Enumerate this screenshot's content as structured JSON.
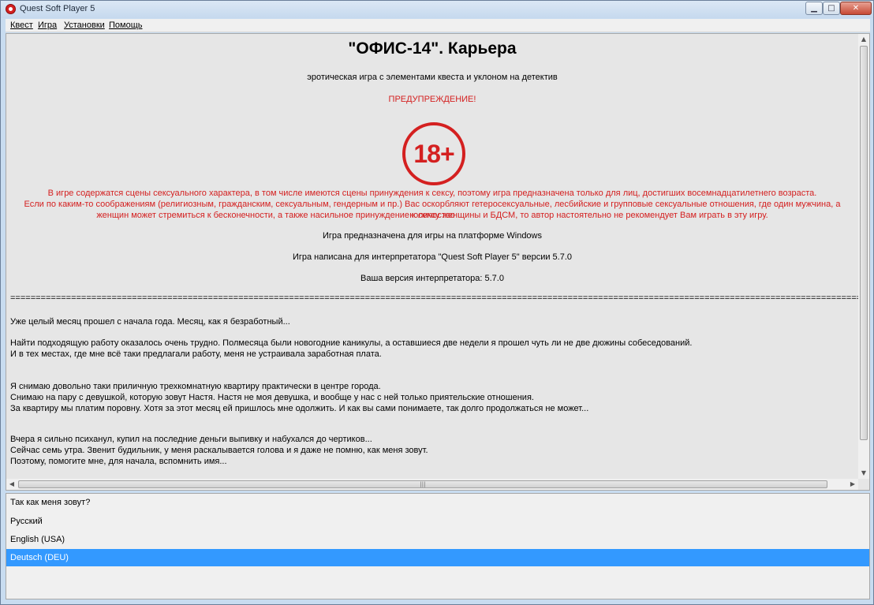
{
  "window": {
    "title": "Quest Soft Player 5",
    "minimize_glyph": "▁",
    "maximize_glyph": "□",
    "close_glyph": "✕"
  },
  "menu": {
    "items": [
      {
        "label": "Квест"
      },
      {
        "label": "Игра"
      },
      {
        "label": "Установки"
      },
      {
        "label": "Помощь"
      }
    ]
  },
  "content": {
    "game_title": "\"ОФИС-14\". Карьера",
    "subtitle": "эротическая игра с элементами квеста и уклоном на детектив",
    "warning_title": "ПРЕДУПРЕЖДЕНИЕ!",
    "age_badge": "18+",
    "warning_lines": [
      "В игре содержатся сцены сексуального характера, в том числе имеются сцены принуждения к сексу, поэтому игра предназначена только для лиц, достигших восемнадцатилетнего возраста.",
      "Если по каким-то соображениям (религиозным, гражданским, сексуальным, гендерным и пр.) Вас оскорбляют гетеросексуальные, лесбийские и групповые сексуальные отношения, где один мужчина, а количество",
      "женщин может стремиться к бесконечности, а также насильное принуждение к сексу женщины и БДСМ, то автор настоятельно не рекомендует Вам играть в эту игру."
    ],
    "info_lines": [
      "Игра предназначена для игры на платформе Windows",
      "Игра написана для интерпретатора \"Quest Soft Player 5\" версии 5.7.0",
      "Ваша версия интерпретатора: 5.7.0"
    ],
    "separator": "==============================================================================================================================================================================================================================",
    "story_lines": [
      "Уже целый месяц прошел с начала года. Месяц, как я безработный...",
      "Найти подходящую работу оказалось очень трудно. Полмесяца были новогодние каникулы, а оставшиеся две недели я прошел чуть ли не две дюжины собеседований.",
      "И в тех местах, где мне всё таки предлагали работу, меня не устраивала заработная плата.",
      "Я снимаю довольно таки приличную трехкомнатную квартиру практически в центре города.",
      "Снимаю на пару с девушкой, которую зовут Настя. Настя не моя девушка, и вообще у нас с ней только приятельские отношения.",
      "За квартиру мы платим поровну. Хотя за этот месяц ей пришлось мне одолжить. И как вы сами понимаете, так долго продолжаться не может...",
      "Вчера я сильно психанул, купил на последние деньги выпивку и набухался до чертиков...",
      "Сейчас семь утра. Звенит будильник, у меня раскалывается голова и я даже не помню, как меня зовут.",
      "Поэтому, помогите мне, для начала, вспомнить имя..."
    ]
  },
  "scrollbar": {
    "up": "▲",
    "down": "▼",
    "left": "◀",
    "right": "▶",
    "grip": "|||"
  },
  "options": {
    "prompt": "Так как меня зовут?",
    "items": [
      {
        "label": "Русский"
      },
      {
        "label": "English (USA)"
      },
      {
        "label": "Deutsch (DEU)"
      }
    ],
    "selected": "Deutsch (DEU)"
  },
  "colors": {
    "warning_red": "#d42020",
    "selection_blue": "#3399ff"
  }
}
